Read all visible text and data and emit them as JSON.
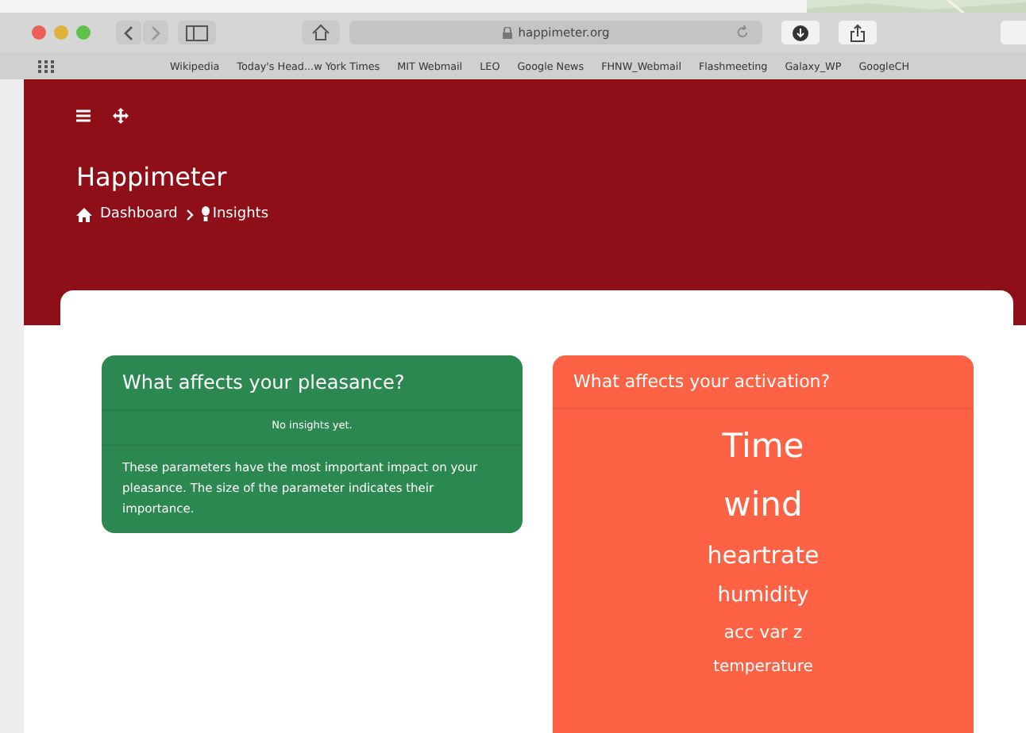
{
  "browser": {
    "url": "happimeter.org",
    "bookmarks": [
      "Wikipedia",
      "Today's Head...w York Times",
      "MIT Webmail",
      "LEO",
      "Google News",
      "FHNW_Webmail",
      "Flashmeeting",
      "Galaxy_WP",
      "GoogleCH"
    ]
  },
  "header": {
    "title": "Happimeter",
    "breadcrumb": [
      "Dashboard",
      "Insights"
    ]
  },
  "pleasance": {
    "title": "What affects your pleasance?",
    "empty": "No insights yet.",
    "note": "These parameters have the most important impact on your pleasance. The size of the parameter indicates their importance."
  },
  "activation": {
    "title": "What affects your activation?",
    "parameters": [
      "Time",
      "wind",
      "heartrate",
      "humidity",
      "acc var z",
      "temperature"
    ]
  }
}
